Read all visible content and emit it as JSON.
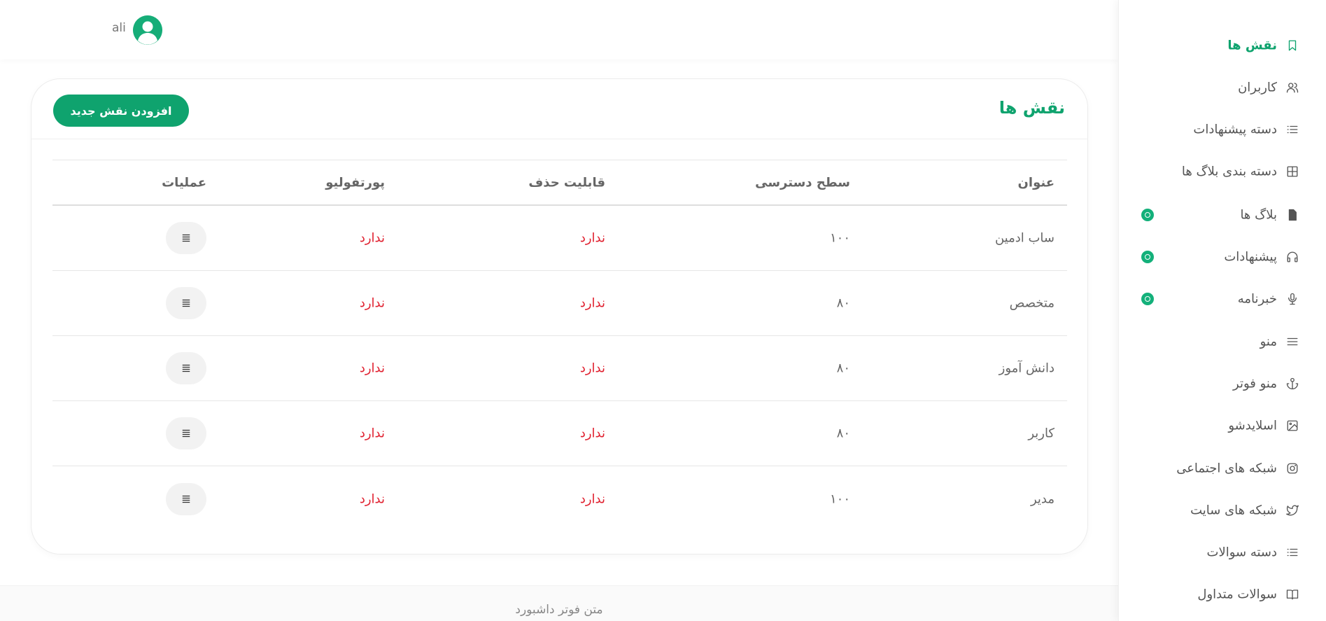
{
  "header": {
    "user_name": "ali"
  },
  "sidebar": {
    "items": [
      {
        "label": "نقش ها",
        "icon": "bookmark-icon",
        "active": true,
        "badge": false
      },
      {
        "label": "کاربران",
        "icon": "users-icon",
        "active": false,
        "badge": false
      },
      {
        "label": "دسته پیشنهادات",
        "icon": "list-icon",
        "active": false,
        "badge": false
      },
      {
        "label": "دسته بندی بلاگ ها",
        "icon": "grid-icon",
        "active": false,
        "badge": false
      },
      {
        "label": "بلاگ ها",
        "icon": "file-icon",
        "active": false,
        "badge": true
      },
      {
        "label": "پیشنهادات",
        "icon": "headphones-icon",
        "active": false,
        "badge": true
      },
      {
        "label": "خبرنامه",
        "icon": "microphone-icon",
        "active": false,
        "badge": true
      },
      {
        "label": "منو",
        "icon": "menu-icon",
        "active": false,
        "badge": false
      },
      {
        "label": "منو فوتر",
        "icon": "anchor-icon",
        "active": false,
        "badge": false
      },
      {
        "label": "اسلایدشو",
        "icon": "image-icon",
        "active": false,
        "badge": false
      },
      {
        "label": "شبکه های اجتماعی",
        "icon": "instagram-icon",
        "active": false,
        "badge": false
      },
      {
        "label": "شبکه های سایت",
        "icon": "twitter-icon",
        "active": false,
        "badge": false
      },
      {
        "label": "دسته سوالات",
        "icon": "list-icon",
        "active": false,
        "badge": false
      },
      {
        "label": "سوالات متداول",
        "icon": "book-icon",
        "active": false,
        "badge": false
      }
    ],
    "accent_color": "#0fa36e"
  },
  "card": {
    "title": "نقش ها",
    "add_button": "افزودن نقش جدید",
    "columns": {
      "title": "عنوان",
      "level": "سطح دسترسی",
      "deletable": "قابلیت حذف",
      "portfolio": "پورتفولیو",
      "operations": "عملیات"
    },
    "rows": [
      {
        "title": "ساب ادمین",
        "level": "۱۰۰",
        "deletable": "ندارد",
        "portfolio": "ندارد"
      },
      {
        "title": "متخصص",
        "level": "۸۰",
        "deletable": "ندارد",
        "portfolio": "ندارد"
      },
      {
        "title": "دانش آموز",
        "level": "۸۰",
        "deletable": "ندارد",
        "portfolio": "ندارد"
      },
      {
        "title": "کاربر",
        "level": "۸۰",
        "deletable": "ندارد",
        "portfolio": "ندارد"
      },
      {
        "title": "مدیر",
        "level": "۱۰۰",
        "deletable": "ندارد",
        "portfolio": "ندارد"
      }
    ],
    "negative_color": "#e0202f"
  },
  "footer": {
    "text": "متن فوتر داشبورد"
  }
}
